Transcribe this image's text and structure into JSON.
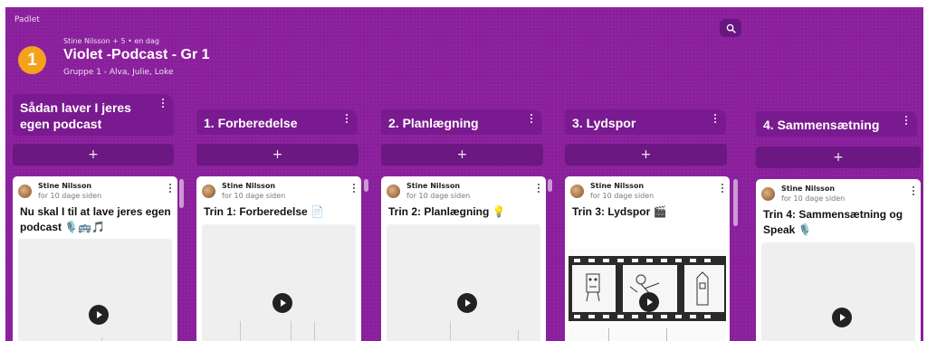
{
  "app": {
    "brand": "Padlet"
  },
  "board": {
    "badge": "1",
    "byline": "Stine Nilsson + 5 • en dag",
    "title": "Violet -Podcast - Gr 1",
    "subtitle": "Gruppe 1 - Alva, Julie, Loke"
  },
  "sections": [
    {
      "title": "Sådan laver I jeres egen podcast",
      "add_label": "+",
      "card": {
        "author": "Stine Nilsson",
        "time": "for 10 dage siden",
        "title": "Nu skal I til at lave jeres egen podcast 🎙️🚌🎵"
      }
    },
    {
      "title": "1. Forberedelse",
      "add_label": "+",
      "card": {
        "author": "Stine Nilsson",
        "time": "for 10 dage siden",
        "title": "Trin 1: Forberedelse 📄"
      }
    },
    {
      "title": "2. Planlægning",
      "add_label": "+",
      "card": {
        "author": "Stine Nilsson",
        "time": "for 10 dage siden",
        "title": "Trin 2: Planlægning 💡"
      }
    },
    {
      "title": "3. Lydspor",
      "add_label": "+",
      "card": {
        "author": "Stine Nilsson",
        "time": "for 10 dage siden",
        "title": "Trin 3: Lydspor 🎬"
      }
    },
    {
      "title": "4. Sammensætning",
      "add_label": "+",
      "card": {
        "author": "Stine Nilsson",
        "time": "for 10 dage siden",
        "title": "Trin 4: Sammensætning og Speak 🎙️"
      }
    }
  ],
  "icons": {
    "search": "search-icon",
    "play": "play-icon",
    "more": "more-vertical-icon"
  },
  "colors": {
    "board_bg": "#8a1f9c",
    "header_bg": "#7a1a90",
    "badge": "#f5a21b"
  }
}
